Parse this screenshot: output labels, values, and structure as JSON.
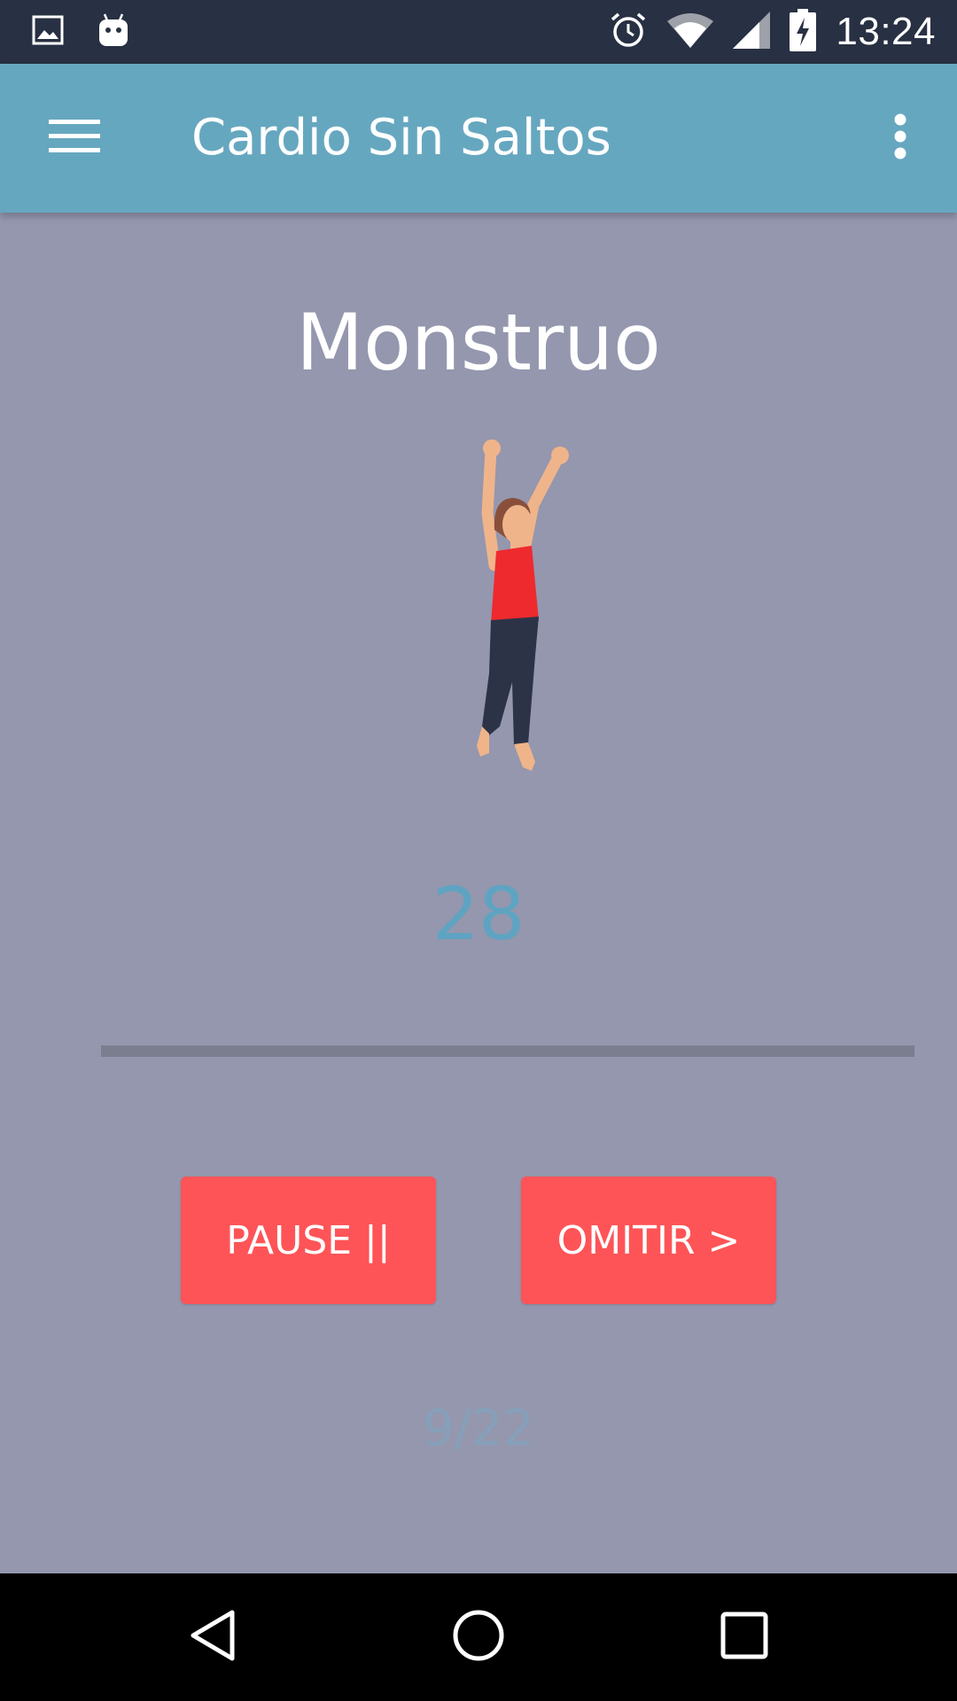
{
  "status_bar": {
    "time": "13:24",
    "left_icons": [
      "image-icon",
      "android-icon"
    ],
    "right_icons": [
      "alarm-icon",
      "wifi-icon",
      "signal-icon",
      "battery-charging-icon"
    ]
  },
  "app_bar": {
    "title": "Cardio Sin Saltos",
    "menu_icon": "hamburger-menu-icon",
    "overflow_icon": "more-vert-icon",
    "color": "#66a7c0"
  },
  "exercise": {
    "name": "Monstruo",
    "illustration": "woman-stretching-arms-up-figure",
    "countdown": "28",
    "progress_fraction": 0.0,
    "counter": "9/22"
  },
  "buttons": {
    "pause_label": "PAUSE ||",
    "skip_label": "OMITIR >",
    "color": "#fe5457"
  },
  "nav_bar": {
    "icons": [
      "back-icon",
      "home-icon",
      "recents-icon"
    ]
  },
  "colors": {
    "background": "#9497ae",
    "status_bar": "#283043",
    "countdown": "#5ea4c2"
  }
}
